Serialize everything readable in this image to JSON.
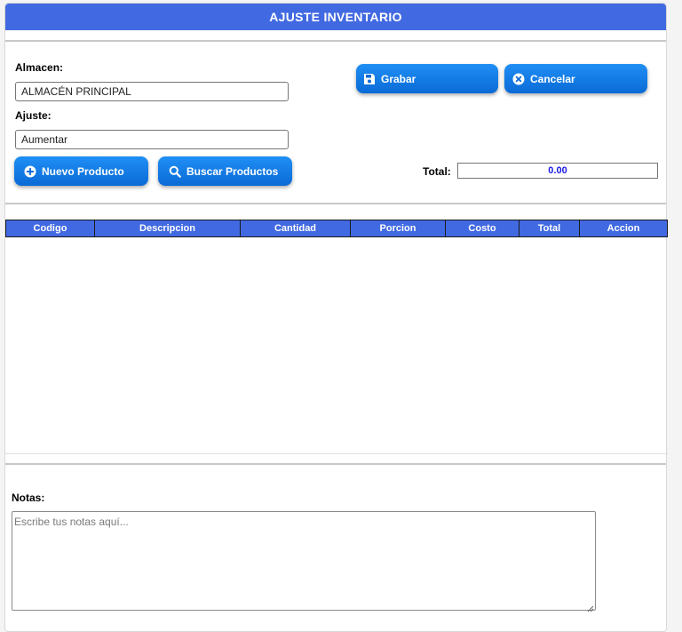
{
  "title": "AJUSTE INVENTARIO",
  "form": {
    "almacen_label": "Almacen:",
    "almacen_value": "ALMACÉN PRINCIPAL",
    "ajuste_label": "Ajuste:",
    "ajuste_value": "Aumentar",
    "total_label": "Total:",
    "total_value": "0.00"
  },
  "buttons": {
    "grabar": "Grabar",
    "cancelar": "Cancelar",
    "nuevo_producto": "Nuevo Producto",
    "buscar_productos": "Buscar Productos"
  },
  "table": {
    "columns": [
      "Codigo",
      "Descripcion",
      "Cantidad",
      "Porcion",
      "Costo",
      "Total",
      "Accion"
    ],
    "rows": []
  },
  "notes": {
    "label": "Notas:",
    "placeholder": "Escribe tus notas aquí..."
  },
  "icons": {
    "grabar": "save-icon",
    "cancelar": "close-circle-icon",
    "nuevo_producto": "plus-circle-icon",
    "buscar_productos": "search-icon"
  },
  "colors": {
    "header": "#4169e1",
    "button": "#0a6ad6",
    "total_text": "#1a1ae6"
  }
}
